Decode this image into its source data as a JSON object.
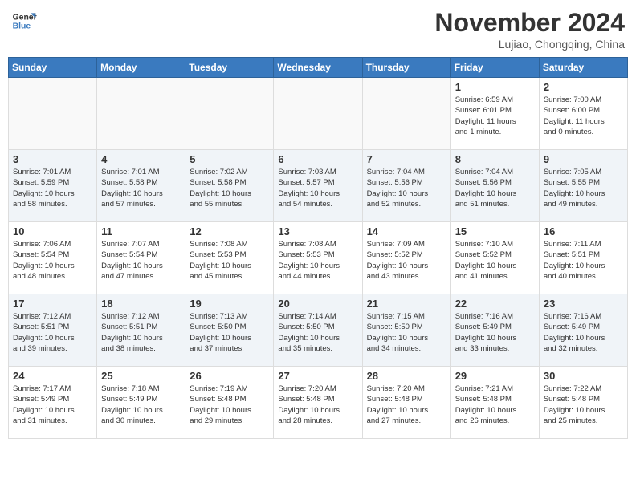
{
  "logo": {
    "line1": "General",
    "line2": "Blue"
  },
  "header": {
    "month": "November 2024",
    "location": "Lujiao, Chongqing, China"
  },
  "weekdays": [
    "Sunday",
    "Monday",
    "Tuesday",
    "Wednesday",
    "Thursday",
    "Friday",
    "Saturday"
  ],
  "weeks": [
    [
      {
        "day": "",
        "info": ""
      },
      {
        "day": "",
        "info": ""
      },
      {
        "day": "",
        "info": ""
      },
      {
        "day": "",
        "info": ""
      },
      {
        "day": "",
        "info": ""
      },
      {
        "day": "1",
        "info": "Sunrise: 6:59 AM\nSunset: 6:01 PM\nDaylight: 11 hours\nand 1 minute."
      },
      {
        "day": "2",
        "info": "Sunrise: 7:00 AM\nSunset: 6:00 PM\nDaylight: 11 hours\nand 0 minutes."
      }
    ],
    [
      {
        "day": "3",
        "info": "Sunrise: 7:01 AM\nSunset: 5:59 PM\nDaylight: 10 hours\nand 58 minutes."
      },
      {
        "day": "4",
        "info": "Sunrise: 7:01 AM\nSunset: 5:58 PM\nDaylight: 10 hours\nand 57 minutes."
      },
      {
        "day": "5",
        "info": "Sunrise: 7:02 AM\nSunset: 5:58 PM\nDaylight: 10 hours\nand 55 minutes."
      },
      {
        "day": "6",
        "info": "Sunrise: 7:03 AM\nSunset: 5:57 PM\nDaylight: 10 hours\nand 54 minutes."
      },
      {
        "day": "7",
        "info": "Sunrise: 7:04 AM\nSunset: 5:56 PM\nDaylight: 10 hours\nand 52 minutes."
      },
      {
        "day": "8",
        "info": "Sunrise: 7:04 AM\nSunset: 5:56 PM\nDaylight: 10 hours\nand 51 minutes."
      },
      {
        "day": "9",
        "info": "Sunrise: 7:05 AM\nSunset: 5:55 PM\nDaylight: 10 hours\nand 49 minutes."
      }
    ],
    [
      {
        "day": "10",
        "info": "Sunrise: 7:06 AM\nSunset: 5:54 PM\nDaylight: 10 hours\nand 48 minutes."
      },
      {
        "day": "11",
        "info": "Sunrise: 7:07 AM\nSunset: 5:54 PM\nDaylight: 10 hours\nand 47 minutes."
      },
      {
        "day": "12",
        "info": "Sunrise: 7:08 AM\nSunset: 5:53 PM\nDaylight: 10 hours\nand 45 minutes."
      },
      {
        "day": "13",
        "info": "Sunrise: 7:08 AM\nSunset: 5:53 PM\nDaylight: 10 hours\nand 44 minutes."
      },
      {
        "day": "14",
        "info": "Sunrise: 7:09 AM\nSunset: 5:52 PM\nDaylight: 10 hours\nand 43 minutes."
      },
      {
        "day": "15",
        "info": "Sunrise: 7:10 AM\nSunset: 5:52 PM\nDaylight: 10 hours\nand 41 minutes."
      },
      {
        "day": "16",
        "info": "Sunrise: 7:11 AM\nSunset: 5:51 PM\nDaylight: 10 hours\nand 40 minutes."
      }
    ],
    [
      {
        "day": "17",
        "info": "Sunrise: 7:12 AM\nSunset: 5:51 PM\nDaylight: 10 hours\nand 39 minutes."
      },
      {
        "day": "18",
        "info": "Sunrise: 7:12 AM\nSunset: 5:51 PM\nDaylight: 10 hours\nand 38 minutes."
      },
      {
        "day": "19",
        "info": "Sunrise: 7:13 AM\nSunset: 5:50 PM\nDaylight: 10 hours\nand 37 minutes."
      },
      {
        "day": "20",
        "info": "Sunrise: 7:14 AM\nSunset: 5:50 PM\nDaylight: 10 hours\nand 35 minutes."
      },
      {
        "day": "21",
        "info": "Sunrise: 7:15 AM\nSunset: 5:50 PM\nDaylight: 10 hours\nand 34 minutes."
      },
      {
        "day": "22",
        "info": "Sunrise: 7:16 AM\nSunset: 5:49 PM\nDaylight: 10 hours\nand 33 minutes."
      },
      {
        "day": "23",
        "info": "Sunrise: 7:16 AM\nSunset: 5:49 PM\nDaylight: 10 hours\nand 32 minutes."
      }
    ],
    [
      {
        "day": "24",
        "info": "Sunrise: 7:17 AM\nSunset: 5:49 PM\nDaylight: 10 hours\nand 31 minutes."
      },
      {
        "day": "25",
        "info": "Sunrise: 7:18 AM\nSunset: 5:49 PM\nDaylight: 10 hours\nand 30 minutes."
      },
      {
        "day": "26",
        "info": "Sunrise: 7:19 AM\nSunset: 5:48 PM\nDaylight: 10 hours\nand 29 minutes."
      },
      {
        "day": "27",
        "info": "Sunrise: 7:20 AM\nSunset: 5:48 PM\nDaylight: 10 hours\nand 28 minutes."
      },
      {
        "day": "28",
        "info": "Sunrise: 7:20 AM\nSunset: 5:48 PM\nDaylight: 10 hours\nand 27 minutes."
      },
      {
        "day": "29",
        "info": "Sunrise: 7:21 AM\nSunset: 5:48 PM\nDaylight: 10 hours\nand 26 minutes."
      },
      {
        "day": "30",
        "info": "Sunrise: 7:22 AM\nSunset: 5:48 PM\nDaylight: 10 hours\nand 25 minutes."
      }
    ]
  ]
}
